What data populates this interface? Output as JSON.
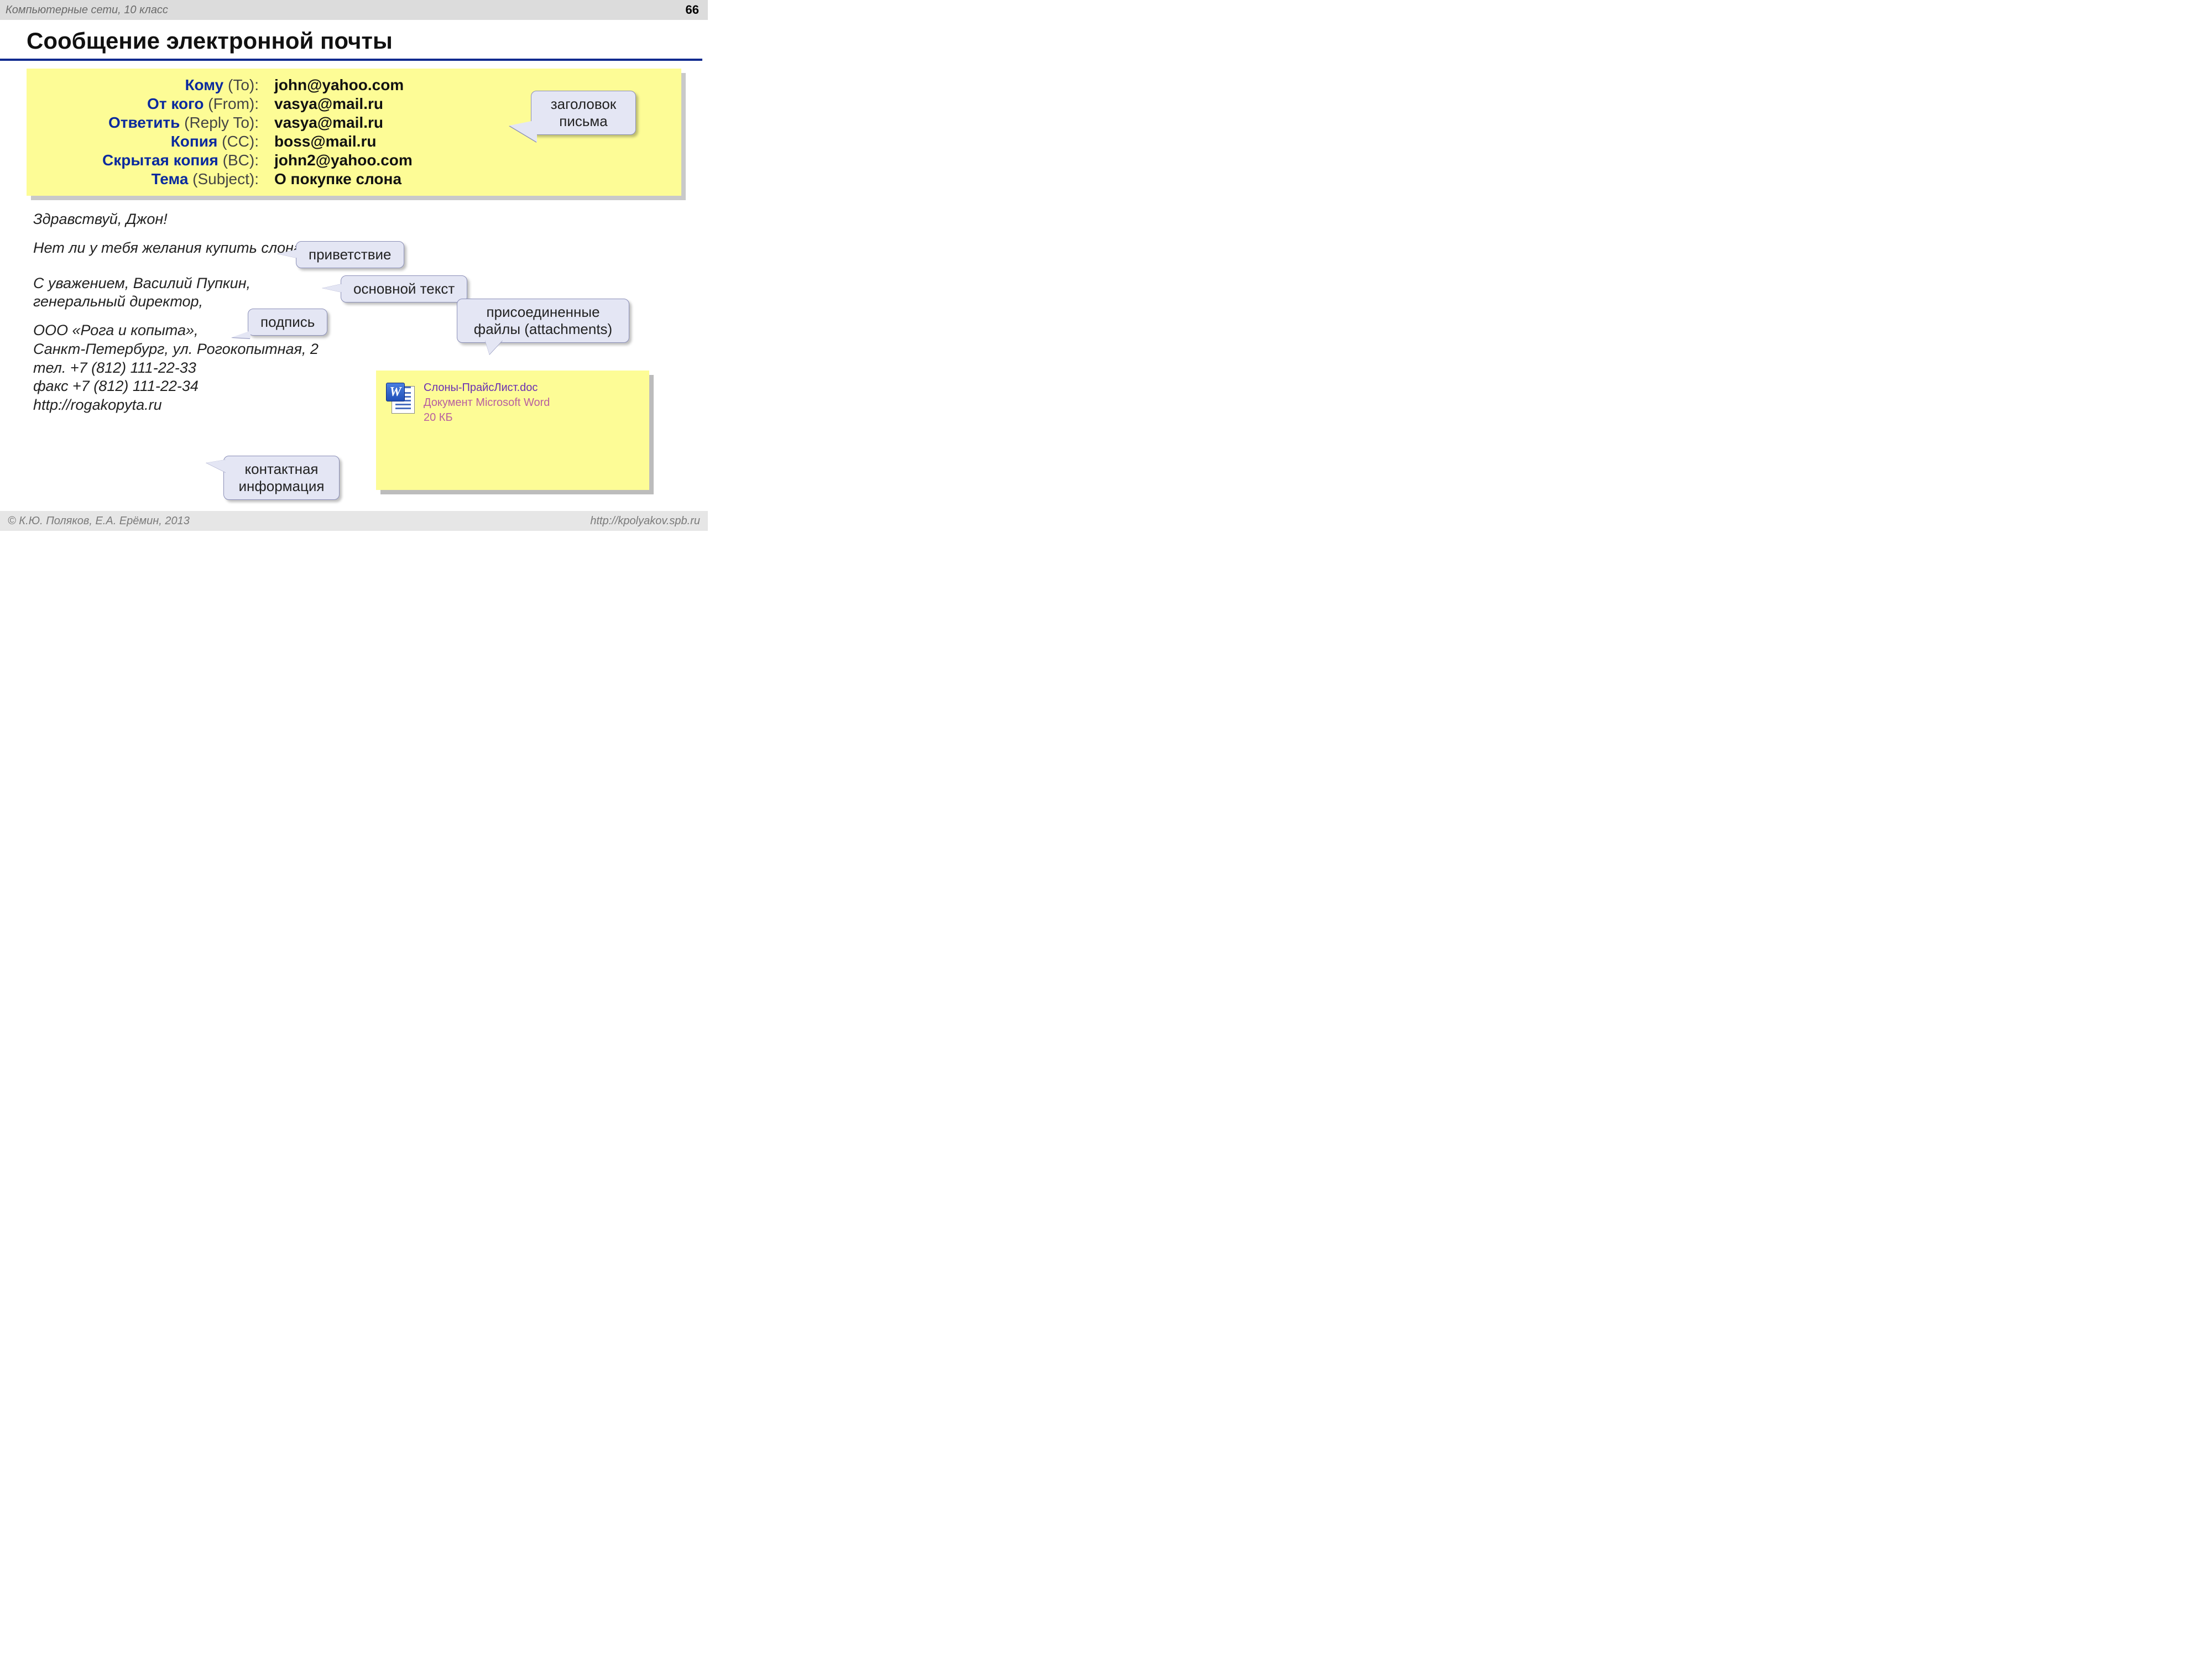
{
  "topbar": {
    "course": "Компьютерные сети, 10 класс",
    "page": "66"
  },
  "title": "Сообщение электронной почты",
  "headers": {
    "rows": [
      {
        "ru": "Кому",
        "en": " (To):",
        "value": "john@yahoo.com"
      },
      {
        "ru": "От кого",
        "en": " (From):",
        "value": "vasya@mail.ru"
      },
      {
        "ru": "Ответить",
        "en": " (Reply To):",
        "value": "vasya@mail.ru"
      },
      {
        "ru": "Копия",
        "en": " (CC):",
        "value": "boss@mail.ru"
      },
      {
        "ru": "Скрытая копия",
        "en": " (BC):",
        "value": "john2@yahoo.com"
      },
      {
        "ru": "Тема",
        "en": " (Subject):",
        "value": "О покупке слона"
      }
    ]
  },
  "callouts": {
    "header": "заголовок письма",
    "greeting": "приветствие",
    "body": "основной текст",
    "signature": "подпись",
    "attachments": "присоединенные файлы (attachments)",
    "contact": "контактная информация"
  },
  "body": {
    "greeting": "Здравствуй, Джон!",
    "main": "Нет ли у тебя желания купить слона?",
    "signature1": "С уважением, Василий Пупкин,",
    "signature2": "генеральный директор,",
    "contact1": "ООО «Рога и копыта»,",
    "contact2": "Санкт-Петербург, ул. Рогокопытная, 2",
    "contact3": "тел. +7 (812) 111-22-33",
    "contact4": "факс +7 (812) 111-22-34",
    "contact5": "http://rogakopyta.ru"
  },
  "attachment": {
    "icon_letter": "W",
    "filename": "Слоны-ПрайсЛист.doc",
    "filetype": "Документ Microsoft Word",
    "filesize": "20 КБ"
  },
  "footer": {
    "left": "© К.Ю. Поляков, Е.А. Ерёмин, 2013",
    "right": "http://kpolyakov.spb.ru"
  }
}
